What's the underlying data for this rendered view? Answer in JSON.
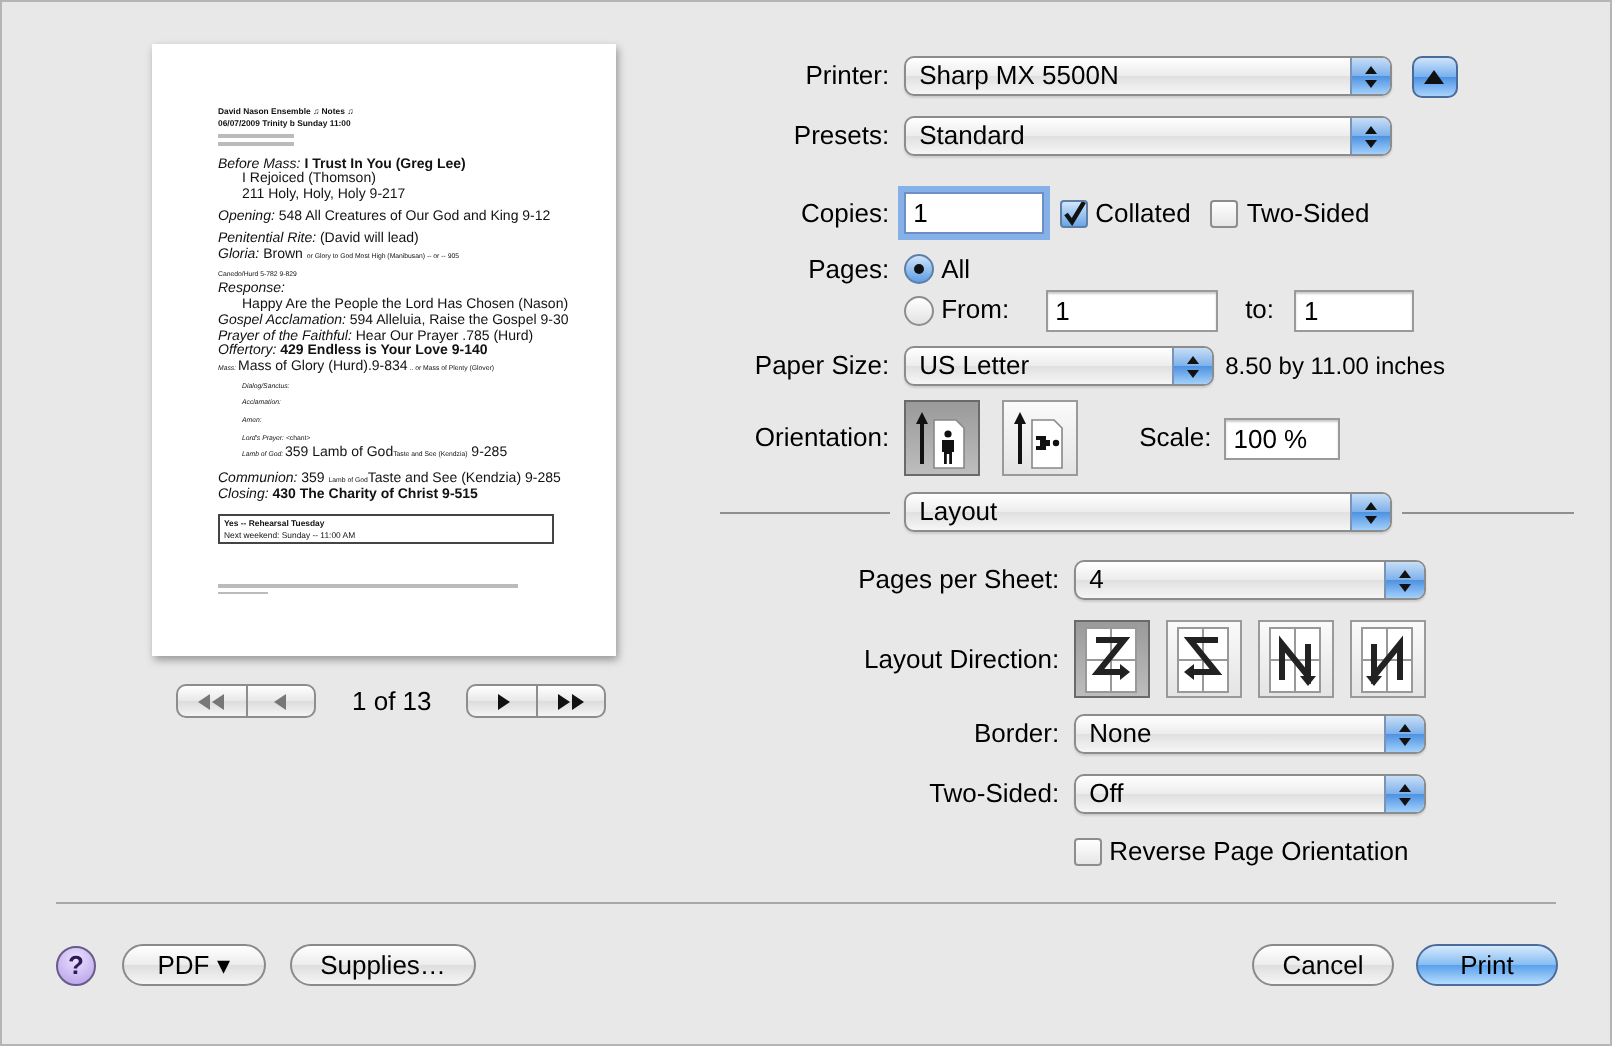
{
  "preview": {
    "document": {
      "blocks": [
        {
          "kind": "plain",
          "lines": [
            {
              "kind": "header",
              "text": "David Nason Ensemble    ♫ Notes ♫"
            },
            {
              "kind": "header",
              "text": "06/07/2009   Trinity b   Sunday 11:00"
            },
            {
              "kind": "illegible"
            },
            {
              "kind": "illegible"
            }
          ]
        },
        {
          "kind": "plain",
          "lines": [
            {
              "kind": "entry",
              "text": "*Before Mass:*  **I Trust In You (Greg Lee)**"
            },
            {
              "kind": "indented",
              "text": "I Rejoiced (Thomson)"
            },
            {
              "kind": "indented",
              "text": "211  Holy, Holy, Holy  9-217"
            }
          ]
        },
        {
          "kind": "plain",
          "lines": [
            {
              "kind": "entry",
              "text": "*Opening:*  548   All Creatures of Our God and King 9-12"
            }
          ]
        },
        {
          "kind": "plain",
          "lines": [
            {
              "kind": "entry",
              "text": "*Penitential Rite:*    (David will lead)"
            },
            {
              "kind": "entry",
              "parts": [
                {
                  "kind": "main",
                  "text": "*Gloria:*  Brown "
                },
                {
                  "kind": "note",
                  "text": "or Glory to God Most High (Manibusan) -- or -- 905"
                }
              ]
            },
            {
              "kind": "entry",
              "parts": [
                {
                  "kind": "note",
                  "text": "Canedo/Hurd  5-782  9-829"
                }
              ]
            },
            {
              "kind": "entry",
              "text": "*Response:*"
            },
            {
              "kind": "indented",
              "text": "Happy Are the People the Lord Has Chosen (Nason)"
            },
            {
              "kind": "entry",
              "text": "*Gospel Acclamation:*   594 Alleluia, Raise the Gospel 9-30"
            },
            {
              "kind": "entry",
              "text": "*Prayer of the Faithful:*   Hear Our Prayer .785 (Hurd)"
            },
            {
              "kind": "entry",
              "text": "*Offertory:*  **429   Endless is Your Love  9-140**"
            },
            {
              "kind": "entry",
              "parts": [
                {
                  "kind": "note",
                  "text": "*Mass:* "
                },
                {
                  "kind": "main",
                  "text": "Mass of Glory (Hurd).9-834"
                },
                {
                  "kind": "note",
                  "text": " .. or Mass of Plenty (Glover)"
                }
              ]
            },
            {
              "kind": "indented",
              "parts": [
                {
                  "kind": "note",
                  "text": "*Dialog/Sanctus:*"
                }
              ]
            },
            {
              "kind": "indented",
              "parts": [
                {
                  "kind": "note",
                  "text": "*Acclamation:*"
                }
              ]
            },
            {
              "kind": "indented",
              "parts": [
                {
                  "kind": "note",
                  "text": "*Amen:*"
                }
              ]
            },
            {
              "kind": "indented",
              "parts": [
                {
                  "kind": "note",
                  "text": "*Lord's Prayer:*  <chant>"
                }
              ]
            },
            {
              "kind": "indented",
              "parts": [
                {
                  "kind": "note",
                  "text": "*Lamb of God:* "
                },
                {
                  "kind": "main",
                  "text": " 359 Lamb of God"
                },
                {
                  "kind": "note",
                  "text": "Taste and See (Kendzia)"
                },
                {
                  "kind": "main",
                  "text": " 9-285"
                }
              ]
            }
          ]
        },
        {
          "kind": "plain",
          "lines": [
            {
              "kind": "entry",
              "parts": [
                {
                  "kind": "main",
                  "text": "*Communion:*  359 "
                },
                {
                  "kind": "note",
                  "text": "Lamb of God"
                },
                {
                  "kind": "main",
                  "text": "Taste and See (Kendzia) 9-285"
                }
              ]
            },
            {
              "kind": "entry",
              "text": "*Closing:*  **430  The Charity of Christ  9-515**"
            }
          ]
        },
        {
          "kind": "boxed",
          "lines": [
            {
              "kind": "header",
              "text": "Yes -- Rehearsal Tuesday"
            },
            {
              "kind": "small",
              "text": "Next weekend: Sunday -- 11:00 AM"
            }
          ]
        },
        {
          "kind": "footer",
          "lines": [
            {
              "kind": "illegible"
            },
            {
              "kind": "illegible"
            }
          ]
        }
      ]
    },
    "page_indicator": "1 of 13"
  },
  "printer": {
    "label": "Printer:",
    "value": "Sharp MX 5500N"
  },
  "presets": {
    "label": "Presets:",
    "value": "Standard"
  },
  "copies": {
    "label": "Copies:",
    "value": "1"
  },
  "collated": {
    "label": "Collated",
    "checked": true
  },
  "two_sided": {
    "label": "Two-Sided",
    "checked": false
  },
  "pages": {
    "label": "Pages:",
    "options": [
      {
        "label": "All",
        "selected": true
      },
      {
        "label": "From:",
        "selected": false
      }
    ],
    "from": "1",
    "to_label": "to:",
    "to": "1"
  },
  "paper_size": {
    "label": "Paper Size:",
    "value": "US Letter",
    "note": "8.50 by 11.00 inches"
  },
  "orientation": {
    "label": "Orientation:",
    "options": [
      {
        "kind": "portrait",
        "selected": true
      },
      {
        "kind": "landscape",
        "selected": false
      }
    ]
  },
  "scale": {
    "label": "Scale:",
    "value": "100 %"
  },
  "panel": {
    "value": "Layout"
  },
  "pages_per_sheet": {
    "label": "Pages per Sheet:",
    "value": "4"
  },
  "layout_direction": {
    "label": "Layout Direction:",
    "options": [
      {
        "kind": "z",
        "selected": true
      },
      {
        "kind": "s",
        "selected": false
      },
      {
        "kind": "nr",
        "selected": false
      },
      {
        "kind": "n",
        "selected": false
      }
    ]
  },
  "border": {
    "label": "Border:",
    "value": "None"
  },
  "two_sided_popup": {
    "label": "Two-Sided:",
    "value": "Off"
  },
  "reverse": {
    "label": "Reverse Page Orientation",
    "checked": false
  },
  "buttons": {
    "help": "?",
    "pdf": "PDF ▾",
    "supplies": "Supplies…",
    "cancel": "Cancel",
    "print": "Print"
  }
}
